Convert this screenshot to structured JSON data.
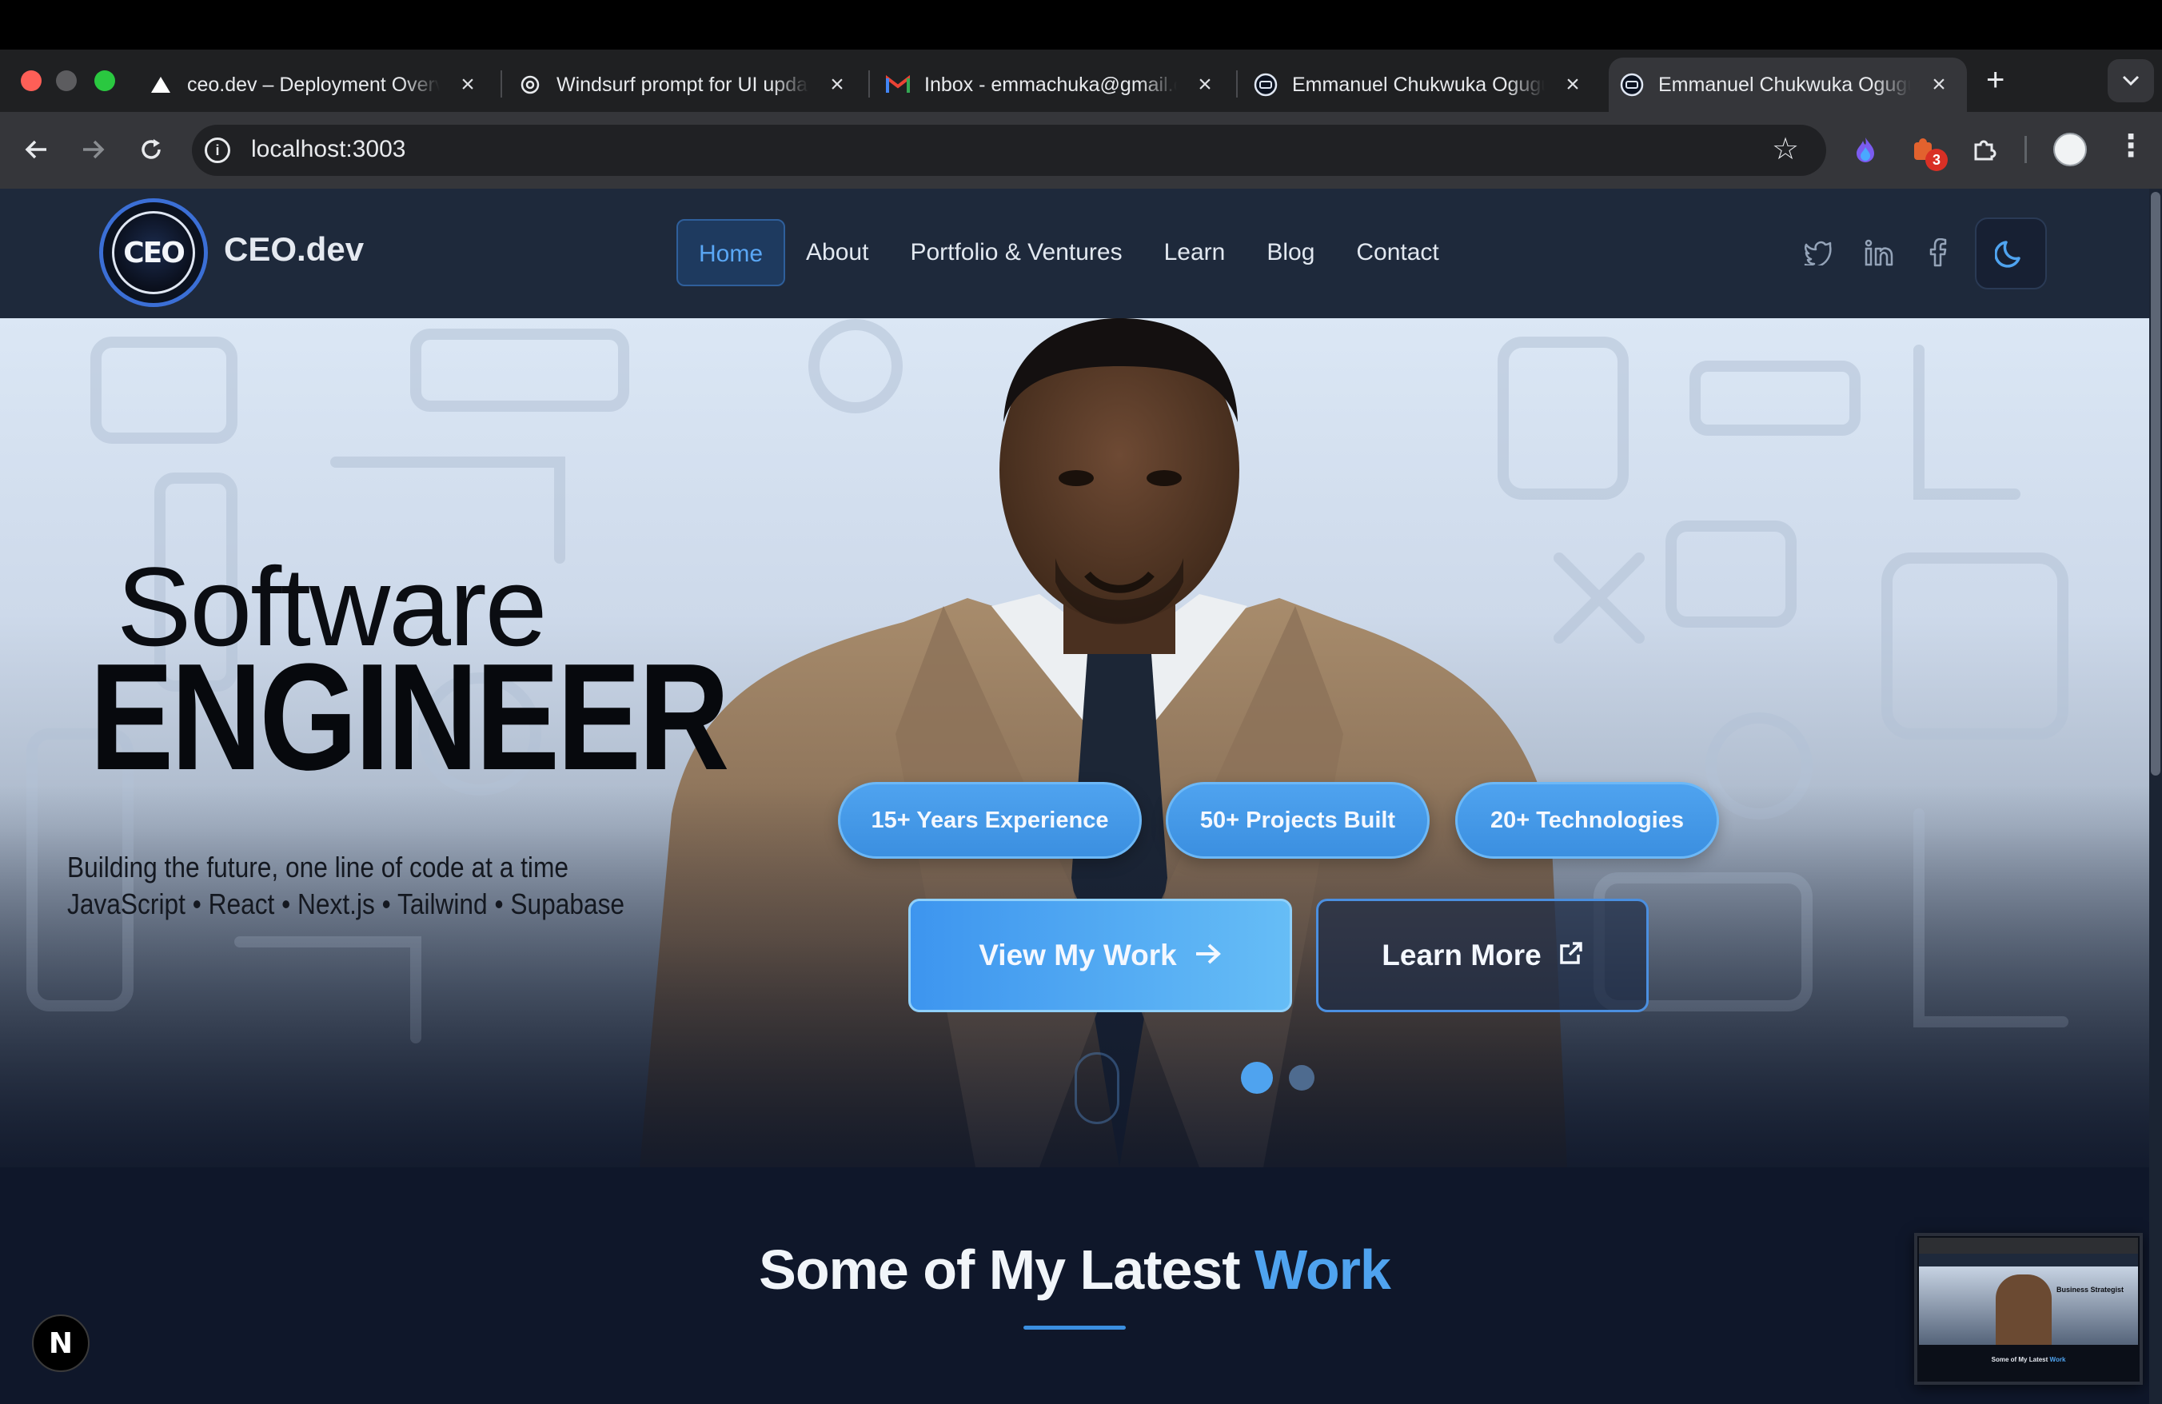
{
  "browser": {
    "tabs": [
      {
        "title": "ceo.dev – Deployment Overview",
        "icon": "vercel-triangle-icon"
      },
      {
        "title": "Windsurf prompt for UI update",
        "icon": "openai-icon"
      },
      {
        "title": "Inbox - emmachuka@gmail.com",
        "icon": "gmail-icon"
      },
      {
        "title": "Emmanuel Chukwuka Ogugua",
        "icon": "ceo-logo-icon"
      },
      {
        "title": "Emmanuel Chukwuka Ogugua",
        "icon": "ceo-logo-icon",
        "active": true
      }
    ],
    "url": "localhost:3003",
    "extension_badge": "3"
  },
  "site": {
    "brand": "CEO.dev",
    "logo_text": "CEO",
    "nav": [
      {
        "label": "Home",
        "active": true
      },
      {
        "label": "About"
      },
      {
        "label": "Portfolio & Ventures"
      },
      {
        "label": "Learn"
      },
      {
        "label": "Blog"
      },
      {
        "label": "Contact"
      }
    ],
    "social": [
      "twitter-icon",
      "linkedin-icon",
      "facebook-icon"
    ],
    "theme_toggle": "moon-icon"
  },
  "hero": {
    "title_line1": "Software",
    "title_line2": "ENGINEER",
    "tagline": "Building the future, one line of code at a time",
    "stack": "JavaScript • React • Next.js • Tailwind • Supabase",
    "stats": [
      "15+ Years Experience",
      "50+ Projects Built",
      "20+ Technologies"
    ],
    "primary_cta": "View My Work",
    "secondary_cta": "Learn More",
    "slides_total": 2,
    "slide_active": 1
  },
  "section": {
    "title_main": "Some of My Latest",
    "title_accent": "Work"
  },
  "overlays": {
    "next_badge": "N",
    "preview_title": "Business Strategist",
    "preview_footer_main": "Some of My Latest",
    "preview_footer_accent": "Work"
  },
  "colors": {
    "accent": "#4fa3ef",
    "nav_bg": "#1e293b",
    "page_bg": "#0f172a"
  }
}
